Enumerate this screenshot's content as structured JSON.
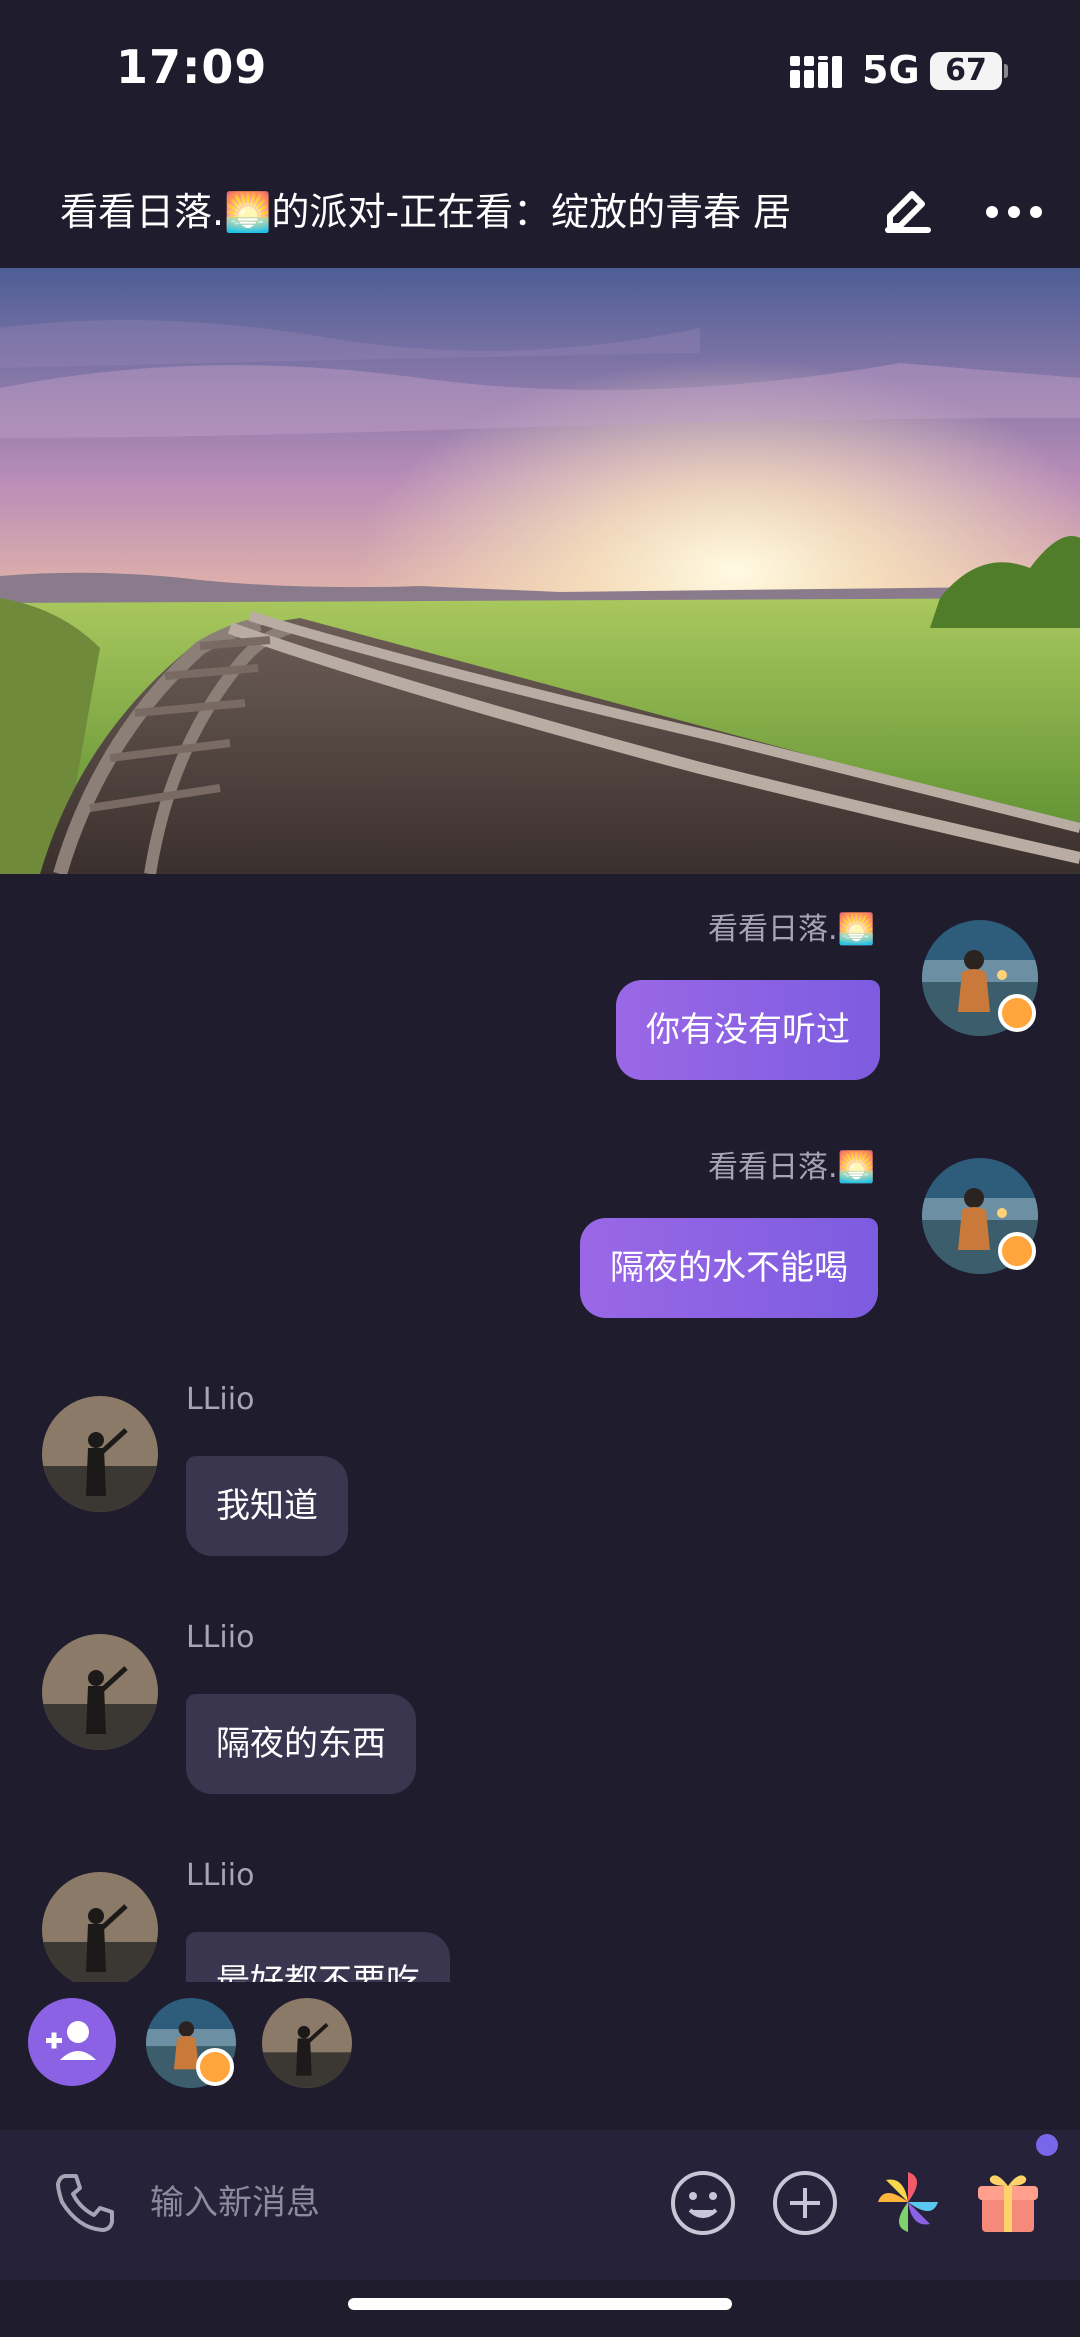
{
  "status_bar": {
    "time": "17:09",
    "network": "5G",
    "battery": "67"
  },
  "header": {
    "title": "看看日落.🌅的派对-正在看：绽放的青春 居",
    "icons": [
      "edit-icon",
      "more-icon"
    ]
  },
  "banner": {
    "description_icon": "sunset-railway-image"
  },
  "messages": [
    {
      "sender": "看看日落.🌅",
      "text": "你有没有听过",
      "mine": true
    },
    {
      "sender": "看看日落.🌅",
      "text": "隔夜的水不能喝",
      "mine": true
    },
    {
      "sender": "LLiio",
      "text": "我知道",
      "mine": false
    },
    {
      "sender": "LLiio",
      "text": "隔夜的东西",
      "mine": false
    },
    {
      "sender": "LLiio",
      "text": "最好都不要吃",
      "mine": false
    }
  ],
  "members": {
    "add_icon": "add-person-icon",
    "count_shown": 2
  },
  "input": {
    "placeholder": "输入新消息",
    "value": ""
  },
  "colors": {
    "background": "#1f1c2e",
    "accent": "#8a62e3",
    "bubble_theirs": "#3a3650",
    "badge": "#ffa53b"
  }
}
